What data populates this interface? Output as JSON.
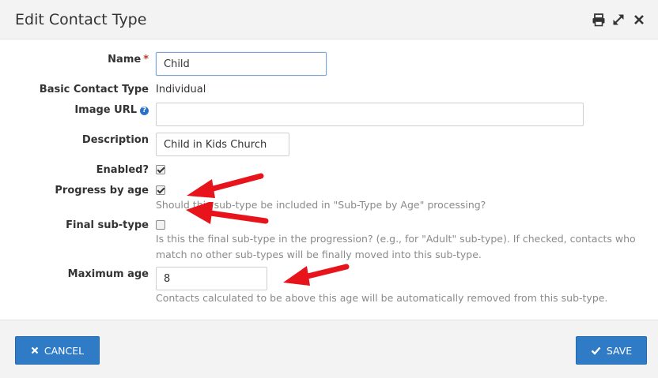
{
  "dialog": {
    "title": "Edit Contact Type"
  },
  "form": {
    "name_label": "Name",
    "name_required": "*",
    "name_value": "Child",
    "basic_contact_type_label": "Basic Contact Type",
    "basic_contact_type_value": "Individual",
    "image_url_label": "Image URL",
    "image_url_value": "",
    "description_label": "Description",
    "description_value": "Child in Kids Church",
    "enabled_label": "Enabled?",
    "enabled_checked": true,
    "progress_label": "Progress by age",
    "progress_checked": true,
    "progress_help": "Should this sub-type be included in \"Sub-Type by Age\" processing?",
    "final_label": "Final sub-type",
    "final_checked": false,
    "final_help": "Is this the final sub-type in the progression? (e.g., for \"Adult\" sub-type). If checked, contacts who match no other sub-types will be finally moved into this sub-type.",
    "max_age_label": "Maximum age",
    "max_age_value": "8",
    "max_age_help": "Contacts calculated to be above this age will be automatically removed from this sub-type."
  },
  "footer": {
    "cancel_label": "CANCEL",
    "save_label": "SAVE"
  },
  "icons": {
    "print": "print-icon",
    "expand": "expand-icon",
    "close": "close-icon",
    "help": "question-circle-icon",
    "cancel": "times-icon",
    "save": "check-icon"
  },
  "colors": {
    "primary_button": "#2f7bc6",
    "required": "#c0392b",
    "annotation_arrow": "#e8141b"
  }
}
